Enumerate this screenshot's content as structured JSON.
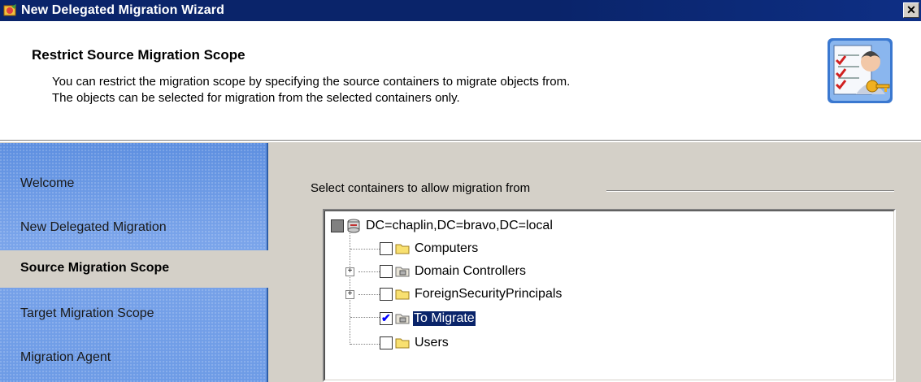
{
  "window": {
    "title": "New Delegated Migration Wizard",
    "close_glyph": "✕"
  },
  "header": {
    "title": "Restrict Source Migration Scope",
    "description_line1": "You can restrict the migration scope by specifying the source containers to migrate objects from.",
    "description_line2": "The objects can be selected for migration from the selected containers only.",
    "icon": "wizard-user-key-icon"
  },
  "sidebar": {
    "items": [
      {
        "label": "Welcome",
        "active": false
      },
      {
        "label": "New Delegated Migration",
        "active": false
      },
      {
        "label": "Source Migration Scope",
        "active": true
      },
      {
        "label": "Target Migration Scope",
        "active": false
      },
      {
        "label": "Migration Agent",
        "active": false
      }
    ]
  },
  "main": {
    "group_label": "Select containers to allow migration from",
    "tree": {
      "root": {
        "label": "DC=chaplin,DC=bravo,DC=local",
        "state": "partial",
        "icon": "domain-icon"
      },
      "children": [
        {
          "label": "Computers",
          "checked": false,
          "icon": "folder-icon",
          "expandable": false
        },
        {
          "label": "Domain Controllers",
          "checked": false,
          "icon": "ou-icon",
          "expandable": true
        },
        {
          "label": "ForeignSecurityPrincipals",
          "checked": false,
          "icon": "folder-icon",
          "expandable": true
        },
        {
          "label": "To Migrate",
          "checked": true,
          "icon": "ou-icon",
          "expandable": false,
          "selected": true
        },
        {
          "label": "Users",
          "checked": false,
          "icon": "folder-icon",
          "expandable": false
        }
      ]
    }
  },
  "colors": {
    "titlebar": "#0a246a",
    "sidebar": "#6d9be6",
    "selection": "#0a246a"
  }
}
